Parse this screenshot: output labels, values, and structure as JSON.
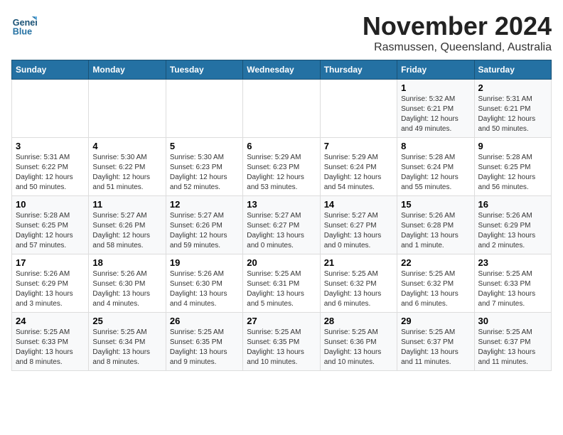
{
  "header": {
    "logo_line1": "General",
    "logo_line2": "Blue",
    "month": "November 2024",
    "location": "Rasmussen, Queensland, Australia"
  },
  "weekdays": [
    "Sunday",
    "Monday",
    "Tuesday",
    "Wednesday",
    "Thursday",
    "Friday",
    "Saturday"
  ],
  "rows": [
    [
      {
        "day": "",
        "info": ""
      },
      {
        "day": "",
        "info": ""
      },
      {
        "day": "",
        "info": ""
      },
      {
        "day": "",
        "info": ""
      },
      {
        "day": "",
        "info": ""
      },
      {
        "day": "1",
        "info": "Sunrise: 5:32 AM\nSunset: 6:21 PM\nDaylight: 12 hours and 49 minutes."
      },
      {
        "day": "2",
        "info": "Sunrise: 5:31 AM\nSunset: 6:21 PM\nDaylight: 12 hours and 50 minutes."
      }
    ],
    [
      {
        "day": "3",
        "info": "Sunrise: 5:31 AM\nSunset: 6:22 PM\nDaylight: 12 hours and 50 minutes."
      },
      {
        "day": "4",
        "info": "Sunrise: 5:30 AM\nSunset: 6:22 PM\nDaylight: 12 hours and 51 minutes."
      },
      {
        "day": "5",
        "info": "Sunrise: 5:30 AM\nSunset: 6:23 PM\nDaylight: 12 hours and 52 minutes."
      },
      {
        "day": "6",
        "info": "Sunrise: 5:29 AM\nSunset: 6:23 PM\nDaylight: 12 hours and 53 minutes."
      },
      {
        "day": "7",
        "info": "Sunrise: 5:29 AM\nSunset: 6:24 PM\nDaylight: 12 hours and 54 minutes."
      },
      {
        "day": "8",
        "info": "Sunrise: 5:28 AM\nSunset: 6:24 PM\nDaylight: 12 hours and 55 minutes."
      },
      {
        "day": "9",
        "info": "Sunrise: 5:28 AM\nSunset: 6:25 PM\nDaylight: 12 hours and 56 minutes."
      }
    ],
    [
      {
        "day": "10",
        "info": "Sunrise: 5:28 AM\nSunset: 6:25 PM\nDaylight: 12 hours and 57 minutes."
      },
      {
        "day": "11",
        "info": "Sunrise: 5:27 AM\nSunset: 6:26 PM\nDaylight: 12 hours and 58 minutes."
      },
      {
        "day": "12",
        "info": "Sunrise: 5:27 AM\nSunset: 6:26 PM\nDaylight: 12 hours and 59 minutes."
      },
      {
        "day": "13",
        "info": "Sunrise: 5:27 AM\nSunset: 6:27 PM\nDaylight: 13 hours and 0 minutes."
      },
      {
        "day": "14",
        "info": "Sunrise: 5:27 AM\nSunset: 6:27 PM\nDaylight: 13 hours and 0 minutes."
      },
      {
        "day": "15",
        "info": "Sunrise: 5:26 AM\nSunset: 6:28 PM\nDaylight: 13 hours and 1 minute."
      },
      {
        "day": "16",
        "info": "Sunrise: 5:26 AM\nSunset: 6:29 PM\nDaylight: 13 hours and 2 minutes."
      }
    ],
    [
      {
        "day": "17",
        "info": "Sunrise: 5:26 AM\nSunset: 6:29 PM\nDaylight: 13 hours and 3 minutes."
      },
      {
        "day": "18",
        "info": "Sunrise: 5:26 AM\nSunset: 6:30 PM\nDaylight: 13 hours and 4 minutes."
      },
      {
        "day": "19",
        "info": "Sunrise: 5:26 AM\nSunset: 6:30 PM\nDaylight: 13 hours and 4 minutes."
      },
      {
        "day": "20",
        "info": "Sunrise: 5:25 AM\nSunset: 6:31 PM\nDaylight: 13 hours and 5 minutes."
      },
      {
        "day": "21",
        "info": "Sunrise: 5:25 AM\nSunset: 6:32 PM\nDaylight: 13 hours and 6 minutes."
      },
      {
        "day": "22",
        "info": "Sunrise: 5:25 AM\nSunset: 6:32 PM\nDaylight: 13 hours and 6 minutes."
      },
      {
        "day": "23",
        "info": "Sunrise: 5:25 AM\nSunset: 6:33 PM\nDaylight: 13 hours and 7 minutes."
      }
    ],
    [
      {
        "day": "24",
        "info": "Sunrise: 5:25 AM\nSunset: 6:33 PM\nDaylight: 13 hours and 8 minutes."
      },
      {
        "day": "25",
        "info": "Sunrise: 5:25 AM\nSunset: 6:34 PM\nDaylight: 13 hours and 8 minutes."
      },
      {
        "day": "26",
        "info": "Sunrise: 5:25 AM\nSunset: 6:35 PM\nDaylight: 13 hours and 9 minutes."
      },
      {
        "day": "27",
        "info": "Sunrise: 5:25 AM\nSunset: 6:35 PM\nDaylight: 13 hours and 10 minutes."
      },
      {
        "day": "28",
        "info": "Sunrise: 5:25 AM\nSunset: 6:36 PM\nDaylight: 13 hours and 10 minutes."
      },
      {
        "day": "29",
        "info": "Sunrise: 5:25 AM\nSunset: 6:37 PM\nDaylight: 13 hours and 11 minutes."
      },
      {
        "day": "30",
        "info": "Sunrise: 5:25 AM\nSunset: 6:37 PM\nDaylight: 13 hours and 11 minutes."
      }
    ]
  ]
}
